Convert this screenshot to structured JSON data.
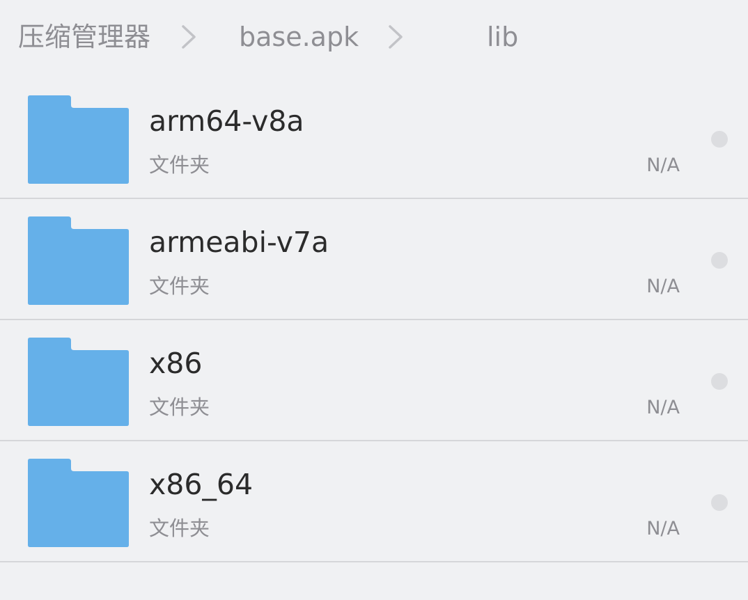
{
  "breadcrumb": {
    "items": [
      {
        "label": "压缩管理器"
      },
      {
        "label": "base.apk"
      },
      {
        "label": "lib"
      }
    ],
    "separator_icon": "chevron-right-icon"
  },
  "files": [
    {
      "name": "arm64-v8a",
      "type": "文件夹",
      "size": "N/A",
      "icon": "folder-icon"
    },
    {
      "name": "armeabi-v7a",
      "type": "文件夹",
      "size": "N/A",
      "icon": "folder-icon"
    },
    {
      "name": "x86",
      "type": "文件夹",
      "size": "N/A",
      "icon": "folder-icon"
    },
    {
      "name": "x86_64",
      "type": "文件夹",
      "size": "N/A",
      "icon": "folder-icon"
    }
  ],
  "colors": {
    "background": "#f0f1f3",
    "folder": "#65b0e9",
    "primary_text": "#2b2b2b",
    "secondary_text": "#8e8e93",
    "divider": "#d5d6d9",
    "select_dot": "#dcdde0"
  }
}
